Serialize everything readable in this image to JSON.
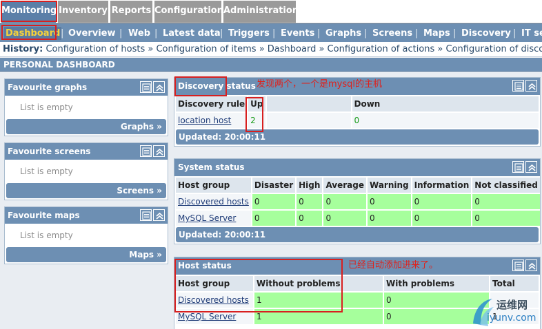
{
  "top_tabs": [
    {
      "label": "Monitoring",
      "active": true
    },
    {
      "label": "Inventory"
    },
    {
      "label": "Reports"
    },
    {
      "label": "Configuration"
    },
    {
      "label": "Administration"
    }
  ],
  "sub_menu": [
    "Dashboard",
    "Overview",
    "Web",
    "Latest data",
    "Triggers",
    "Events",
    "Graphs",
    "Screens",
    "Maps",
    "Discovery",
    "IT se"
  ],
  "history": {
    "label": "History:",
    "items": [
      "Configuration of hosts",
      "Configuration of items",
      "Dashboard",
      "Configuration of actions",
      "Configuration of discover"
    ]
  },
  "page_title": "PERSONAL DASHBOARD",
  "favourites": [
    {
      "title": "Favourite graphs",
      "empty": "List is empty",
      "footer": "Graphs »"
    },
    {
      "title": "Favourite screens",
      "empty": "List is empty",
      "footer": "Screens »"
    },
    {
      "title": "Favourite maps",
      "empty": "List is empty",
      "footer": "Maps »"
    }
  ],
  "discovery": {
    "title": "Discovery status",
    "headers": [
      "Discovery rule",
      "Up",
      "",
      "Down"
    ],
    "rows": [
      {
        "rule": "location host",
        "up": "2",
        "down": "0"
      }
    ],
    "updated": "Updated: 20:00:11"
  },
  "system_status": {
    "title": "System status",
    "headers": [
      "Host group",
      "Disaster",
      "High",
      "Average",
      "Warning",
      "Information",
      "Not classified"
    ],
    "rows": [
      {
        "group": "Discovered hosts",
        "values": [
          "0",
          "0",
          "0",
          "0",
          "0",
          "0"
        ]
      },
      {
        "group": "MySQL Server",
        "values": [
          "0",
          "0",
          "0",
          "0",
          "0",
          "0"
        ]
      }
    ],
    "updated": "Updated: 20:00:11"
  },
  "host_status": {
    "title": "Host status",
    "headers": [
      "Host group",
      "Without problems",
      "With problems",
      "Total"
    ],
    "rows": [
      {
        "group": "Discovered hosts",
        "without": "1",
        "with": "0",
        "total": ""
      },
      {
        "group": "MySQL Server",
        "without": "1",
        "with": "0",
        "total": "1"
      }
    ]
  },
  "annotations": {
    "discovery_note": "发现两个，一个是mysql的主机",
    "host_note": "已经自动添加进来了。"
  },
  "watermark": {
    "brand": "运维网",
    "domain": "iyunv.com"
  },
  "colors": {
    "header_blue": "#6d8fb3",
    "ok_green": "#a6ff9c",
    "active_sub": "#f6d23a",
    "annotation_red": "#d81f1f"
  }
}
